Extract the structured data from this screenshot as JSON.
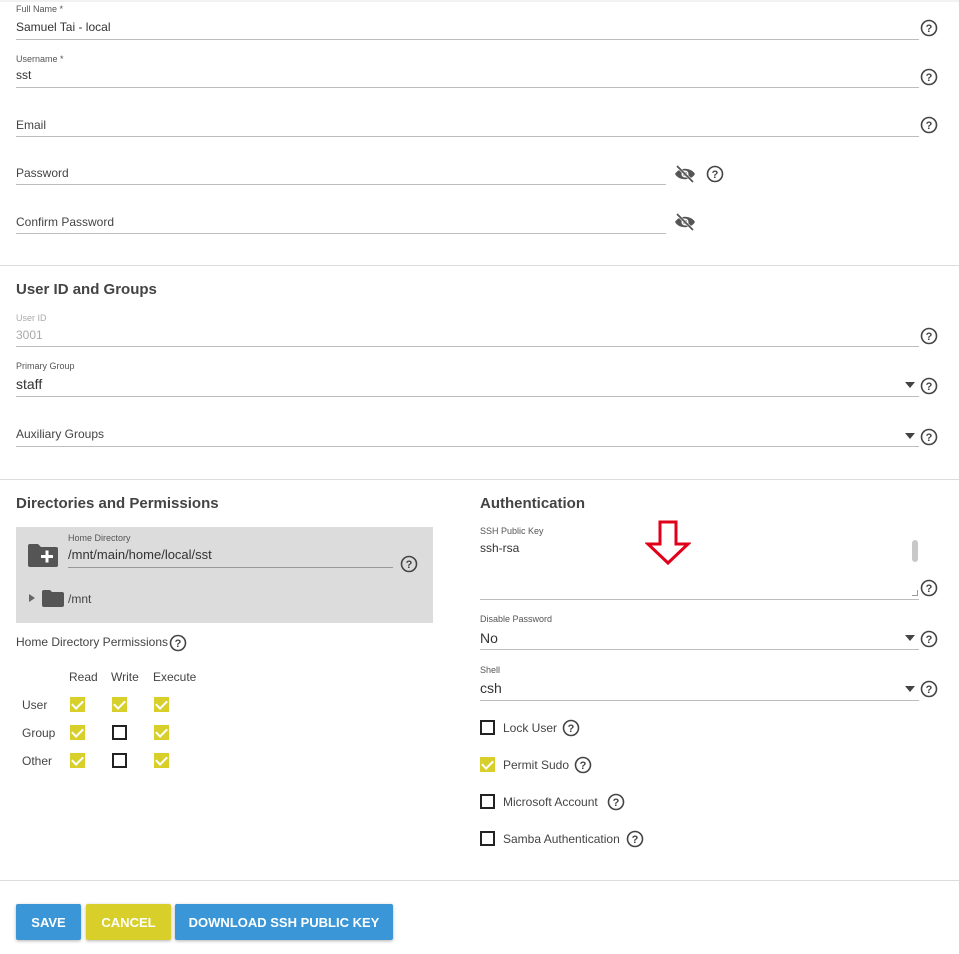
{
  "identification": {
    "full_name": {
      "label": "Full Name *",
      "value": "Samuel Tai - local"
    },
    "username": {
      "label": "Username *",
      "value": "sst"
    },
    "email": {
      "placeholder": "Email"
    },
    "password": {
      "placeholder": "Password"
    },
    "confirm_password": {
      "placeholder": "Confirm Password"
    }
  },
  "user_id_groups": {
    "title": "User ID and Groups",
    "user_id": {
      "label": "User ID",
      "value": "3001"
    },
    "primary_group": {
      "label": "Primary Group",
      "value": "staff"
    },
    "auxiliary_groups": {
      "placeholder": "Auxiliary Groups"
    }
  },
  "directories": {
    "title": "Directories and Permissions",
    "home_directory": {
      "label": "Home Directory",
      "value": "/mnt/main/home/local/sst"
    },
    "tree_node": "/mnt",
    "permissions_label": "Home Directory Permissions",
    "columns": [
      "Read",
      "Write",
      "Execute"
    ],
    "rows": [
      {
        "name": "User",
        "read": true,
        "write": true,
        "execute": true
      },
      {
        "name": "Group",
        "read": true,
        "write": false,
        "execute": true
      },
      {
        "name": "Other",
        "read": true,
        "write": false,
        "execute": true
      }
    ]
  },
  "authentication": {
    "title": "Authentication",
    "ssh_key": {
      "label": "SSH Public Key",
      "value": "ssh-rsa"
    },
    "disable_password": {
      "label": "Disable Password",
      "value": "No"
    },
    "shell": {
      "label": "Shell",
      "value": "csh"
    },
    "checkboxes": [
      {
        "label": "Lock User",
        "checked": false
      },
      {
        "label": "Permit Sudo",
        "checked": true
      },
      {
        "label": "Microsoft Account",
        "checked": false
      },
      {
        "label": "Samba Authentication",
        "checked": false
      }
    ]
  },
  "actions": {
    "save": "SAVE",
    "cancel": "CANCEL",
    "download": "DOWNLOAD SSH PUBLIC KEY"
  },
  "colors": {
    "primary": "#3a96d6",
    "accent": "#d8cf2b",
    "annotation_arrow": "#e0001a"
  }
}
